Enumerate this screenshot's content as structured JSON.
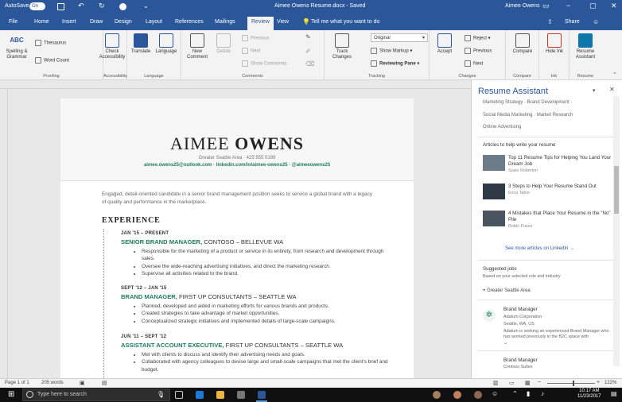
{
  "titlebar": {
    "autosave": "AutoSave",
    "autosave_state": "On",
    "doc_title": "Aimee Owens Resume.docx - Saved",
    "user": "Aimee Owens"
  },
  "tabs": [
    "File",
    "Home",
    "Insert",
    "Draw",
    "Design",
    "Layout",
    "References",
    "Mailings",
    "Review",
    "View"
  ],
  "tell_me": "Tell me what you want to do",
  "share": "Share",
  "ribbon": {
    "proofing": {
      "label": "Proofing",
      "spelling": "Spelling & Grammar",
      "thesaurus": "Thesaurus",
      "word_count": "Word Count"
    },
    "accessibility": {
      "label": "Accessibility",
      "check": "Check Accessibility"
    },
    "language": {
      "label": "Language",
      "translate": "Translate",
      "language": "Language"
    },
    "comments": {
      "label": "Comments",
      "new": "New Comment",
      "delete": "Delete",
      "previous": "Previous",
      "next": "Next",
      "show": "Show Comments"
    },
    "tracking": {
      "label": "Tracking",
      "track": "Track Changes",
      "markup": "Original",
      "show_markup": "Show Markup",
      "reviewing": "Reviewing Pane"
    },
    "changes": {
      "label": "Changes",
      "accept": "Accept",
      "reject": "Reject",
      "previous": "Previous",
      "next": "Next"
    },
    "compare": {
      "label": "Compare",
      "compare": "Compare"
    },
    "ink": {
      "label": "Ink",
      "hide": "Hide Ink"
    },
    "resume": {
      "label": "Resume",
      "assistant": "Resume Assistant"
    }
  },
  "resume": {
    "first": "AIMEE",
    "last": "OWENS",
    "contact": "Greater Seattle Area  ·  425 555 0199",
    "links": "aimee.owens25@outlook.com · linkedin.com/in/aimee-owens25 · @aimeeowens25",
    "summary": "Engaged, detail-oriented candidate in a senior brand management position seeks to service a global brand with a legacy of quality and performance in the marketplace.",
    "exp_heading": "EXPERIENCE",
    "jobs": [
      {
        "dates": "JAN '15 – PRESENT",
        "title": "SENIOR BRAND MANAGER,",
        "org": " CONTOSO – BELLEVUE WA",
        "bullets": [
          "Responsible for the marketing of a product or service in its entirety, from research and development through sales.",
          "Oversee the wide-reaching advertising initiatives, and direct the marketing research.",
          "Supervise all activities related to the brand."
        ]
      },
      {
        "dates": "SEPT '12 – JAN '15",
        "title": "BRAND MANAGER,",
        "org": " FIRST UP CONSULTANTS – SEATTLE WA",
        "bullets": [
          "Planned, developed and aided in marketing efforts for various brands and products.",
          "Created strategies to take advantage of market opportunities.",
          "Conceptualized strategic initiatives and implemented details of large-scale campaigns."
        ]
      },
      {
        "dates": "JUN '11 – SEPT '12",
        "title": "ASSISTANT ACCOUNT EXECUTIVE,",
        "org": " FIRST UP CONSULTANTS – SEATTLE WA",
        "bullets": [
          "Met with clients to discuss and identify their advertising needs and goals.",
          "Collaborated with agency colleagues to devise large and small-scale campaigns that met the client's brief and budget."
        ]
      }
    ]
  },
  "pane": {
    "title": "Resume Assistant",
    "skills1": "Marketing Strategy · Brand Development ·",
    "skills2": "Social Media Marketing · Market Research",
    "skills3": "Online Advertising",
    "articles_head": "Articles to help write your resume",
    "articles": [
      {
        "title": "Top 11 Resume Tips for Helping You Land Your Dream Job",
        "author": "Susie Roberton"
      },
      {
        "title": "3 Steps to Help Your Resume Stand Out",
        "author": "Erica Tabor"
      },
      {
        "title": "4 Mistakes that Place Your Resume in the \"No\" Pile",
        "author": "Robin Fusco"
      }
    ],
    "more": "See more articles on LinkedIn",
    "jobs_head": "Suggested jobs",
    "jobs_sub": "Based on your selected role and industry",
    "location": "Greater Seattle Area",
    "job1": {
      "title": "Brand Manager",
      "company": "Adatum Corporation",
      "location": "Seattle, WA, US",
      "desc": "Adatum is seeking an experienced Brand Manager who has worked previously in the B2C space with"
    },
    "job2": {
      "title": "Brand Manager",
      "company": "Contoso Suites"
    }
  },
  "status": {
    "page": "Page 1 of 1",
    "words": "205 words",
    "zoom": "122%"
  },
  "taskbar": {
    "search": "Type here to search",
    "time": "10:17 AM",
    "date": "11/23/2017"
  },
  "colors": {
    "word_blue": "#2b579a",
    "accent_green": "#1e7b5e"
  }
}
